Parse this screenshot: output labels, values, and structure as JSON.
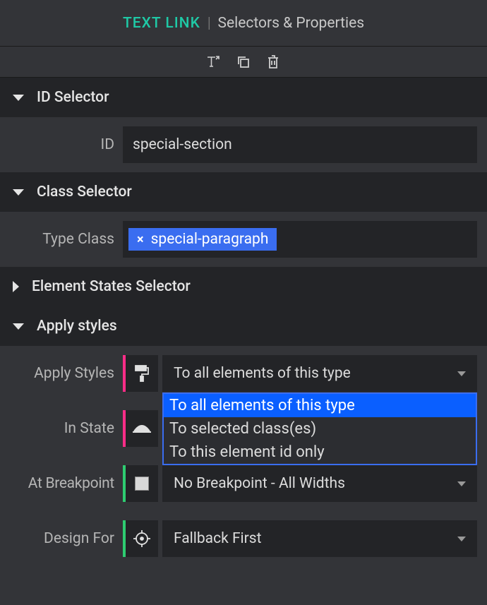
{
  "header": {
    "component": "TEXT LINK",
    "title": "Selectors & Properties"
  },
  "sections": {
    "id_selector": {
      "title": "ID Selector",
      "id_label": "ID",
      "id_value": "special-section"
    },
    "class_selector": {
      "title": "Class Selector",
      "type_class_label": "Type Class",
      "class_value": "special-paragraph"
    },
    "element_states": {
      "title": "Element States Selector"
    },
    "apply_styles": {
      "title": "Apply styles",
      "apply_styles_label": "Apply Styles",
      "apply_styles_value": "To all elements of this type",
      "apply_styles_options": [
        "To all elements of this type",
        "To selected class(es)",
        "To this element id only"
      ],
      "in_state_label": "In State",
      "at_breakpoint_label": "At Breakpoint",
      "at_breakpoint_value": "No Breakpoint - All Widths",
      "design_for_label": "Design For",
      "design_for_value": "Fallback First"
    }
  }
}
